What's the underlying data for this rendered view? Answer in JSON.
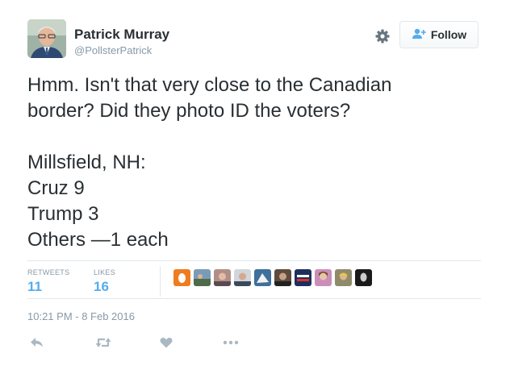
{
  "user": {
    "name": "Patrick Murray",
    "handle": "@PollsterPatrick"
  },
  "follow_label": "Follow",
  "tweet": {
    "lines_a": [
      "Hmm. Isn't that very close to the Canadian",
      "border? Did they photo ID the voters?"
    ],
    "lines_b": [
      "Millsfield, NH:",
      "Cruz 9",
      "Trump 3",
      "Others —1 each"
    ]
  },
  "stats": {
    "retweets_label": "RETWEETS",
    "retweets_count": "11",
    "likes_label": "LIKES",
    "likes_count": "16"
  },
  "timestamp": "10:21 PM - 8 Feb 2016",
  "colors": {
    "accent": "#55acee",
    "muted": "#8899a6",
    "text": "#292f33",
    "border": "#e1e8ed"
  },
  "icons": {
    "settings": "gear-icon",
    "follow": "add-user-icon",
    "reply": "reply-icon",
    "retweet": "retweet-icon",
    "like": "heart-icon",
    "more": "more-icon"
  }
}
